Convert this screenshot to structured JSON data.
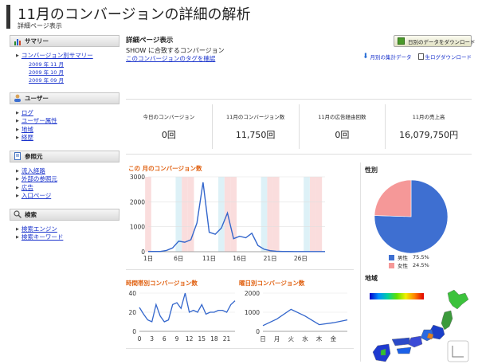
{
  "header": {
    "title": "11月のコンバージョンの詳細の解析",
    "subtitle": "詳細ページ表示"
  },
  "sidebar": {
    "sections": [
      {
        "title": "サマリー",
        "icon": "bar-chart-icon",
        "items": [
          {
            "label": "コンバージョン別サマリー",
            "sub": false
          },
          {
            "label": "2009 年 11 月",
            "sub": true
          },
          {
            "label": "2009 年 10 月",
            "sub": true
          },
          {
            "label": "2009 年 09 月",
            "sub": true
          }
        ]
      },
      {
        "title": "ユーザー",
        "icon": "user-icon",
        "items": [
          {
            "label": "ログ",
            "sub": false
          },
          {
            "label": "ユーザー属性",
            "sub": false
          },
          {
            "label": "地域",
            "sub": false
          },
          {
            "label": "経歴",
            "sub": false
          }
        ]
      },
      {
        "title": "参照元",
        "icon": "document-icon",
        "items": [
          {
            "label": "流入経路",
            "sub": false
          },
          {
            "label": "外部の参照元",
            "sub": false
          },
          {
            "label": "広告",
            "sub": false
          },
          {
            "label": "入口ページ",
            "sub": false
          }
        ]
      },
      {
        "title": "検索",
        "icon": "magnifier-icon",
        "items": [
          {
            "label": "検索エンジン",
            "sub": false
          },
          {
            "label": "検索キーワード",
            "sub": false
          }
        ]
      }
    ]
  },
  "main": {
    "heading": "詳細ページ表示",
    "description": "SHOW に合致するコンバージョン",
    "tag_link": "このコンバージョンのタグを確認",
    "download_button": "日別のデータをダウンロード",
    "monthly_link": "月別の集計データ",
    "raw_log_link": "生ログダウンロード"
  },
  "summary": [
    {
      "label": "今日のコンバージョン",
      "value": "0回"
    },
    {
      "label": "11月のコンバージョン数",
      "value": "11,750回"
    },
    {
      "label": "11月の広告経由回数",
      "value": "0回"
    },
    {
      "label": "11月の売上高",
      "value": "16,079,750円"
    }
  ],
  "colors": {
    "line": "#3366cc",
    "accent_title": "#e06010",
    "male": "#3e6fd1",
    "female": "#f59898",
    "weekend_red": "#fadddd",
    "weekend_blue": "#ddf1f7"
  },
  "gender": {
    "title": "性別",
    "items": [
      {
        "label": "男性",
        "pct": "75.5%"
      },
      {
        "label": "女性",
        "pct": "24.5%"
      }
    ]
  },
  "region": {
    "title": "地域"
  },
  "chart_data": [
    {
      "type": "line",
      "title": "この 月のコンバージョン数",
      "x": [
        1,
        2,
        3,
        4,
        5,
        6,
        7,
        8,
        9,
        10,
        11,
        12,
        13,
        14,
        15,
        16,
        17,
        18,
        19,
        20,
        21,
        22,
        23,
        24,
        25,
        26,
        27,
        28,
        29,
        30
      ],
      "values": [
        10,
        10,
        10,
        50,
        150,
        420,
        380,
        480,
        1150,
        2780,
        780,
        700,
        950,
        1550,
        520,
        620,
        560,
        740,
        250,
        100,
        40,
        20,
        10,
        10,
        5,
        5,
        5,
        5,
        5,
        5
      ],
      "x_ticks": [
        "1日",
        "6日",
        "11日",
        "16日",
        "21日",
        "26日"
      ],
      "y_ticks": [
        "0",
        "1000",
        "2000",
        "3000"
      ],
      "ylim": [
        0,
        3000
      ],
      "shaded_red_days": [
        1,
        7,
        8,
        14,
        15,
        21,
        22,
        28,
        29
      ],
      "shaded_blue_days": [
        6,
        13,
        20,
        27
      ]
    },
    {
      "type": "line",
      "title": "時間帯別コンバージョン数",
      "x": [
        0,
        1,
        2,
        3,
        4,
        5,
        6,
        7,
        8,
        9,
        10,
        11,
        12,
        13,
        14,
        15,
        16,
        17,
        18,
        19,
        20,
        21,
        22,
        23
      ],
      "values": [
        25,
        18,
        12,
        10,
        28,
        16,
        10,
        12,
        28,
        30,
        24,
        40,
        20,
        22,
        20,
        28,
        18,
        20,
        20,
        22,
        22,
        20,
        28,
        32
      ],
      "x_ticks": [
        "0",
        "3",
        "6",
        "9",
        "12",
        "15",
        "18",
        "21"
      ],
      "y_ticks": [
        "0",
        "20",
        "40"
      ],
      "ylim": [
        0,
        40
      ]
    },
    {
      "type": "line",
      "title": "曜日別コンバージョン数",
      "categories": [
        "日",
        "月",
        "火",
        "水",
        "木",
        "金",
        ""
      ],
      "values": [
        300,
        650,
        1150,
        800,
        350,
        450,
        600
      ],
      "y_ticks": [
        "0",
        "1000",
        "2000"
      ],
      "ylim": [
        0,
        2000
      ]
    },
    {
      "type": "pie",
      "title": "性別",
      "labels": [
        "男性",
        "女性"
      ],
      "values": [
        75.5,
        24.5
      ]
    }
  ]
}
